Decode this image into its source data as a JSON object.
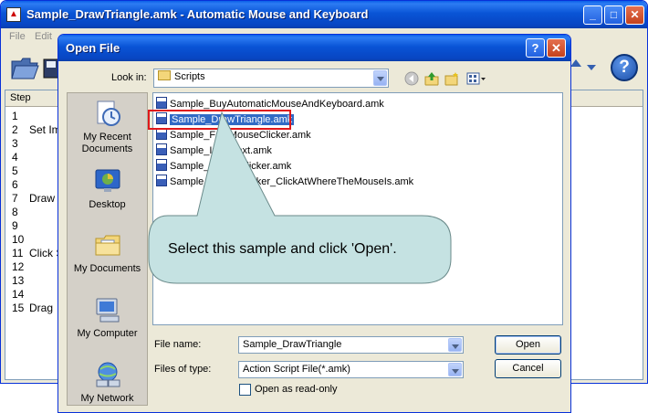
{
  "main_window": {
    "title": "Sample_DrawTriangle.amk - Automatic Mouse and Keyboard",
    "menu": [
      "File",
      "Edit"
    ],
    "step_header": "Step",
    "steps": [
      {
        "num": "1",
        "text": ""
      },
      {
        "num": "2",
        "text": "Set Im"
      },
      {
        "num": "3",
        "text": ""
      },
      {
        "num": "4",
        "text": ""
      },
      {
        "num": "5",
        "text": ""
      },
      {
        "num": "6",
        "text": ""
      },
      {
        "num": "7",
        "text": "Draw T"
      },
      {
        "num": "8",
        "text": ""
      },
      {
        "num": "9",
        "text": ""
      },
      {
        "num": "10",
        "text": ""
      },
      {
        "num": "11",
        "text": "Click S"
      },
      {
        "num": "12",
        "text": ""
      },
      {
        "num": "13",
        "text": ""
      },
      {
        "num": "14",
        "text": ""
      },
      {
        "num": "15",
        "text": "Drag"
      }
    ],
    "help_glyph": "?"
  },
  "dialog": {
    "title": "Open File",
    "help_glyph": "?",
    "close_glyph": "✕",
    "look_in_label": "Look in:",
    "look_in_value": "Scripts",
    "places": [
      {
        "label": "My Recent Documents",
        "icon": "recent-documents-icon"
      },
      {
        "label": "Desktop",
        "icon": "desktop-icon"
      },
      {
        "label": "My Documents",
        "icon": "my-documents-icon"
      },
      {
        "label": "My Computer",
        "icon": "my-computer-icon"
      },
      {
        "label": "My Network",
        "icon": "my-network-icon"
      }
    ],
    "files": [
      {
        "name": "Sample_BuyAutomaticMouseAndKeyboard.amk",
        "selected": false
      },
      {
        "name": "Sample_DrawTriangle.amk",
        "selected": true
      },
      {
        "name": "Sample_FastMouseClicker.amk",
        "selected": false
      },
      {
        "name": "Sample_InputText.amk",
        "selected": false
      },
      {
        "name": "Sample_MouseClicker.amk",
        "selected": false
      },
      {
        "name": "Sample_MouseClicker_ClickAtWhereTheMouseIs.amk",
        "selected": false
      }
    ],
    "callout_text": "Select this sample and click 'Open'.",
    "file_name_label": "File name:",
    "file_name_value": "Sample_DrawTriangle",
    "file_type_label": "Files of type:",
    "file_type_value": "Action Script File(*.amk)",
    "open_readonly_label": "Open as read-only",
    "open_readonly_checked": false,
    "open_button": "Open",
    "cancel_button": "Cancel"
  },
  "colors": {
    "titlebar": "#0954d6",
    "selection": "#316ac5",
    "highlight_box": "#e0181a",
    "callout_fill": "#c5e2e2"
  }
}
